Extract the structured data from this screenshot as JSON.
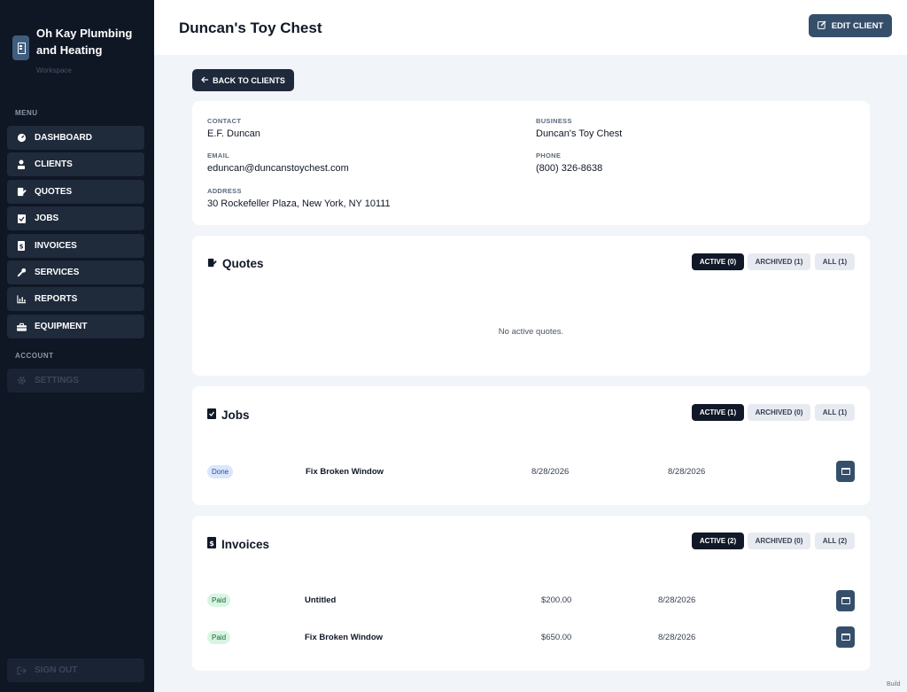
{
  "brand": {
    "name": "Oh Kay Plumbing and Heating",
    "subtitle": "Workspace"
  },
  "sidebar": {
    "menu_label": "MENU",
    "items": [
      {
        "label": "DASHBOARD",
        "icon": "dashboard-icon"
      },
      {
        "label": "CLIENTS",
        "icon": "user-icon"
      },
      {
        "label": "QUOTES",
        "icon": "quote-icon"
      },
      {
        "label": "JOBS",
        "icon": "clipboard-icon"
      },
      {
        "label": "INVOICES",
        "icon": "invoice-icon"
      },
      {
        "label": "SERVICES",
        "icon": "wrench-icon"
      },
      {
        "label": "REPORTS",
        "icon": "chart-icon"
      },
      {
        "label": "EQUIPMENT",
        "icon": "toolbox-icon"
      }
    ],
    "account_label": "ACCOUNT",
    "settings_label": "SETTINGS",
    "signout_label": "SIGN OUT"
  },
  "header": {
    "title": "Duncan's Toy Chest",
    "edit_label": "EDIT CLIENT"
  },
  "back_label": "BACK TO CLIENTS",
  "client": {
    "contact_label": "CONTACT",
    "contact": "E.F. Duncan",
    "business_label": "BUSINESS",
    "business": "Duncan's Toy Chest",
    "email_label": "EMAIL",
    "email": "eduncan@duncanstoychest.com",
    "phone_label": "PHONE",
    "phone": "(800) 326-8638",
    "address_label": "ADDRESS",
    "address": "30 Rockefeller Plaza, New York, NY 10111"
  },
  "quotes": {
    "title": "Quotes",
    "tabs": [
      "ACTIVE (0)",
      "ARCHIVED (1)",
      "ALL (1)"
    ],
    "empty": "No active quotes."
  },
  "jobs": {
    "title": "Jobs",
    "tabs": [
      "ACTIVE (1)",
      "ARCHIVED (0)",
      "ALL (1)"
    ],
    "rows": [
      {
        "status": "Done",
        "title": "Fix Broken Window",
        "date1": "8/28/2026",
        "date2": "8/28/2026"
      }
    ]
  },
  "invoices": {
    "title": "Invoices",
    "tabs": [
      "ACTIVE (2)",
      "ARCHIVED (0)",
      "ALL (2)"
    ],
    "rows": [
      {
        "status": "Paid",
        "title": "Untitled",
        "amount": "$200.00",
        "date": "8/28/2026"
      },
      {
        "status": "Paid",
        "title": "Fix Broken Window",
        "amount": "$650.00",
        "date": "8/28/2026"
      }
    ]
  },
  "footer": {
    "build": "Build"
  },
  "colors": {
    "sidebar": "#0f1624",
    "accent": "#354f6b",
    "active_pill": "#111827",
    "done_badge": "#dbe6fb",
    "paid_badge": "#d8f4e2"
  }
}
